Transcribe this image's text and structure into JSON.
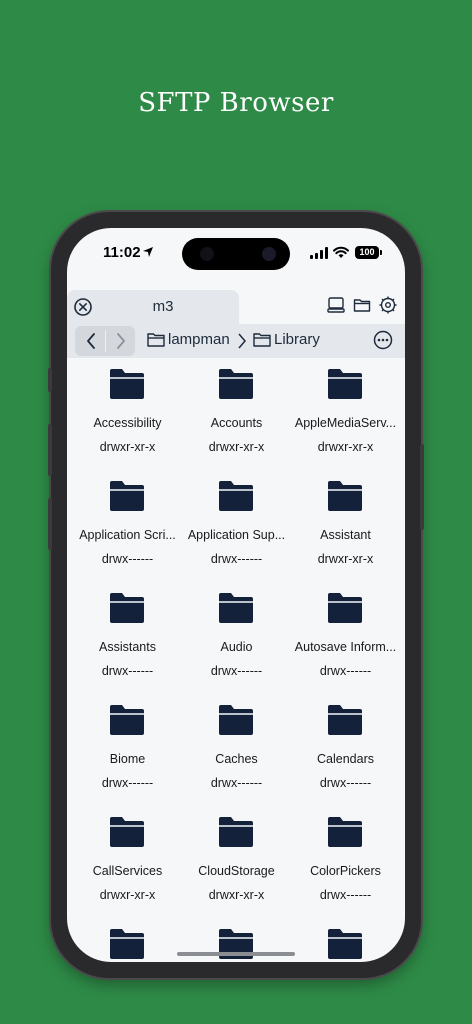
{
  "promo": {
    "title": "SFTP Browser"
  },
  "status": {
    "time": "11:02",
    "battery": "100"
  },
  "tab": {
    "title": "m3"
  },
  "path": {
    "segments": [
      "lampman",
      "Library"
    ]
  },
  "colors": {
    "background": "#2e8b47",
    "folder": "#14213a",
    "accent": "#1d2b3c"
  },
  "items": [
    {
      "name": "Accessibility",
      "perm": "drwxr-xr-x"
    },
    {
      "name": "Accounts",
      "perm": "drwxr-xr-x"
    },
    {
      "name": "AppleMediaServ...",
      "perm": "drwxr-xr-x"
    },
    {
      "name": "Application Scri...",
      "perm": "drwx------"
    },
    {
      "name": "Application Sup...",
      "perm": "drwx------"
    },
    {
      "name": "Assistant",
      "perm": "drwxr-xr-x"
    },
    {
      "name": "Assistants",
      "perm": "drwx------"
    },
    {
      "name": "Audio",
      "perm": "drwx------"
    },
    {
      "name": "Autosave Inform...",
      "perm": "drwx------"
    },
    {
      "name": "Biome",
      "perm": "drwx------"
    },
    {
      "name": "Caches",
      "perm": "drwx------"
    },
    {
      "name": "Calendars",
      "perm": "drwx------"
    },
    {
      "name": "CallServices",
      "perm": "drwxr-xr-x"
    },
    {
      "name": "CloudStorage",
      "perm": "drwxr-xr-x"
    },
    {
      "name": "ColorPickers",
      "perm": "drwx------"
    }
  ]
}
